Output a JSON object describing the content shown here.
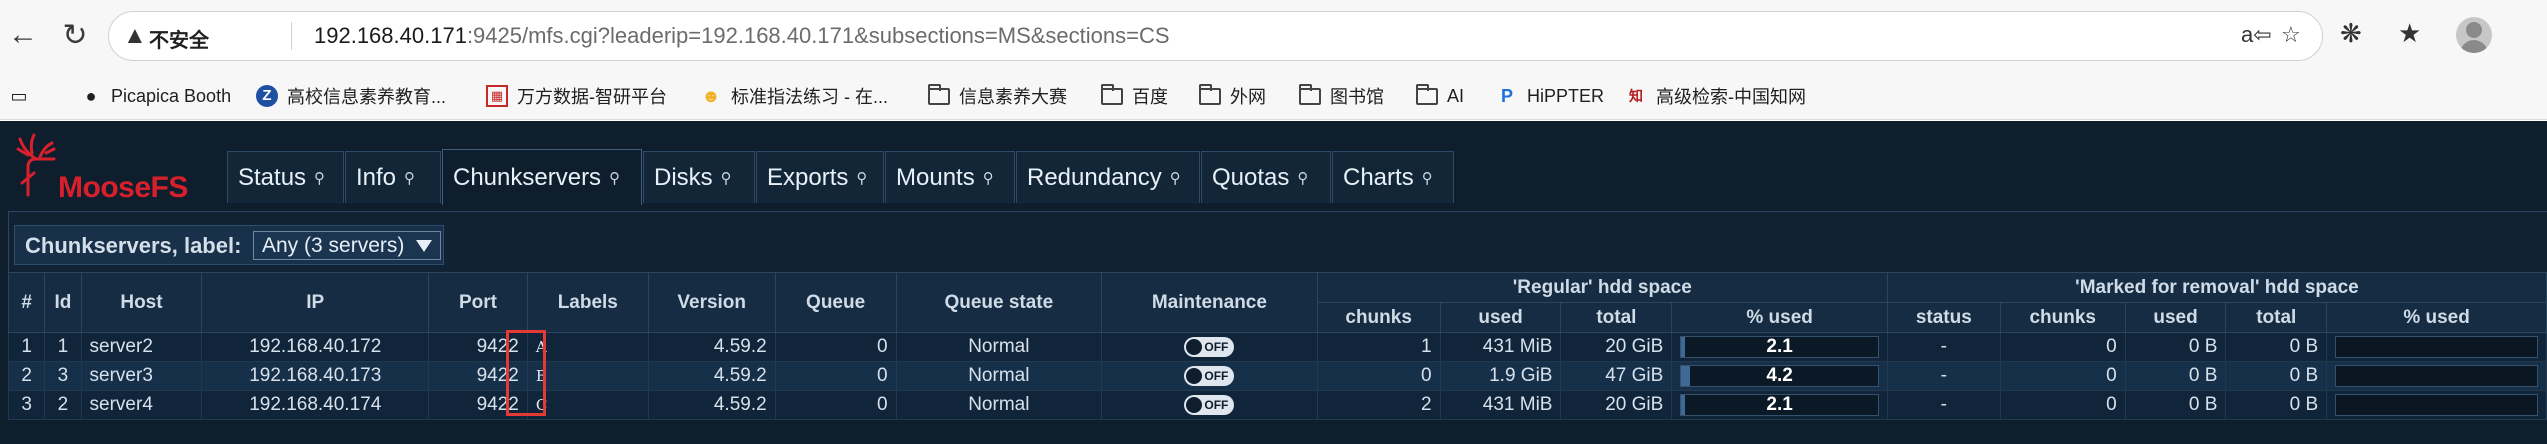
{
  "browser": {
    "insecure_label": "不安全",
    "url_host": "192.168.40.171",
    "url_rest": ":9425/mfs.cgi?leaderip=192.168.40.171&subsections=MS&sections=CS",
    "icons": [
      "back-icon",
      "refresh-icon",
      "warning-icon",
      "read-aloud-icon",
      "favorite-star-icon",
      "extensions-icon",
      "favorites-icon",
      "collections-icon",
      "profile-avatar"
    ]
  },
  "bookmarks": [
    {
      "label": "Picapica Booth",
      "icon": "picapica-icon"
    },
    {
      "label": "高校信息素养教育...",
      "icon": "z-icon"
    },
    {
      "label": "万方数据-智研平台",
      "icon": "wanfang-icon"
    },
    {
      "label": "标准指法练习 - 在...",
      "icon": "typing-icon"
    },
    {
      "label": "信息素养大赛",
      "icon": "folder-icon"
    },
    {
      "label": "百度",
      "icon": "folder-icon"
    },
    {
      "label": "外网",
      "icon": "folder-icon"
    },
    {
      "label": "图书馆",
      "icon": "folder-icon"
    },
    {
      "label": "AI",
      "icon": "folder-icon"
    },
    {
      "label": "HiPPTER",
      "icon": "hippter-icon"
    },
    {
      "label": "高级检索-中国知网",
      "icon": "cnki-icon"
    }
  ],
  "app": {
    "logo_text": "MooseFS",
    "tabs": [
      {
        "label": "Status"
      },
      {
        "label": "Info"
      },
      {
        "label": "Chunkservers"
      },
      {
        "label": "Disks"
      },
      {
        "label": "Exports"
      },
      {
        "label": "Mounts"
      },
      {
        "label": "Redundancy"
      },
      {
        "label": "Quotas"
      },
      {
        "label": "Charts"
      }
    ],
    "active_tab": "Chunkservers",
    "label_filter": {
      "title": "Chunkservers, label:",
      "selected": "Any (3 servers)"
    }
  },
  "table": {
    "group_regular": "'Regular' hdd space",
    "group_removal": "'Marked for removal' hdd space",
    "headers": {
      "num": "#",
      "id": "Id",
      "host": "Host",
      "ip": "IP",
      "port": "Port",
      "labels": "Labels",
      "version": "Version",
      "queue": "Queue",
      "queue_state": "Queue state",
      "maintenance": "Maintenance",
      "chunks": "chunks",
      "used": "used",
      "total": "total",
      "pct": "% used",
      "status": "status"
    },
    "rows": [
      {
        "num": "1",
        "id": "1",
        "host": "server2",
        "ip": "192.168.40.172",
        "port": "9422",
        "label": "A",
        "version": "4.59.2",
        "queue": "0",
        "queue_state": "Normal",
        "maint": "OFF",
        "chunks": "1",
        "used": "431 MiB",
        "total": "20 GiB",
        "pct": "2.1",
        "pct_value": 2.1,
        "r_status": "-",
        "r_chunks": "0",
        "r_used": "0 B",
        "r_total": "0 B"
      },
      {
        "num": "2",
        "id": "3",
        "host": "server3",
        "ip": "192.168.40.173",
        "port": "9422",
        "label": "B",
        "version": "4.59.2",
        "queue": "0",
        "queue_state": "Normal",
        "maint": "OFF",
        "chunks": "0",
        "used": "1.9 GiB",
        "total": "47 GiB",
        "pct": "4.2",
        "pct_value": 4.2,
        "r_status": "-",
        "r_chunks": "0",
        "r_used": "0 B",
        "r_total": "0 B"
      },
      {
        "num": "3",
        "id": "2",
        "host": "server4",
        "ip": "192.168.40.174",
        "port": "9422",
        "label": "C",
        "version": "4.59.2",
        "queue": "0",
        "queue_state": "Normal",
        "maint": "OFF",
        "chunks": "2",
        "used": "431 MiB",
        "total": "20 GiB",
        "pct": "2.1",
        "pct_value": 2.1,
        "r_status": "-",
        "r_chunks": "0",
        "r_used": "0 B",
        "r_total": "0 B"
      }
    ]
  },
  "colors": {
    "app_bg": "#0e1e2d",
    "logo_red": "#d8202c",
    "highlight_red": "#e53935"
  }
}
